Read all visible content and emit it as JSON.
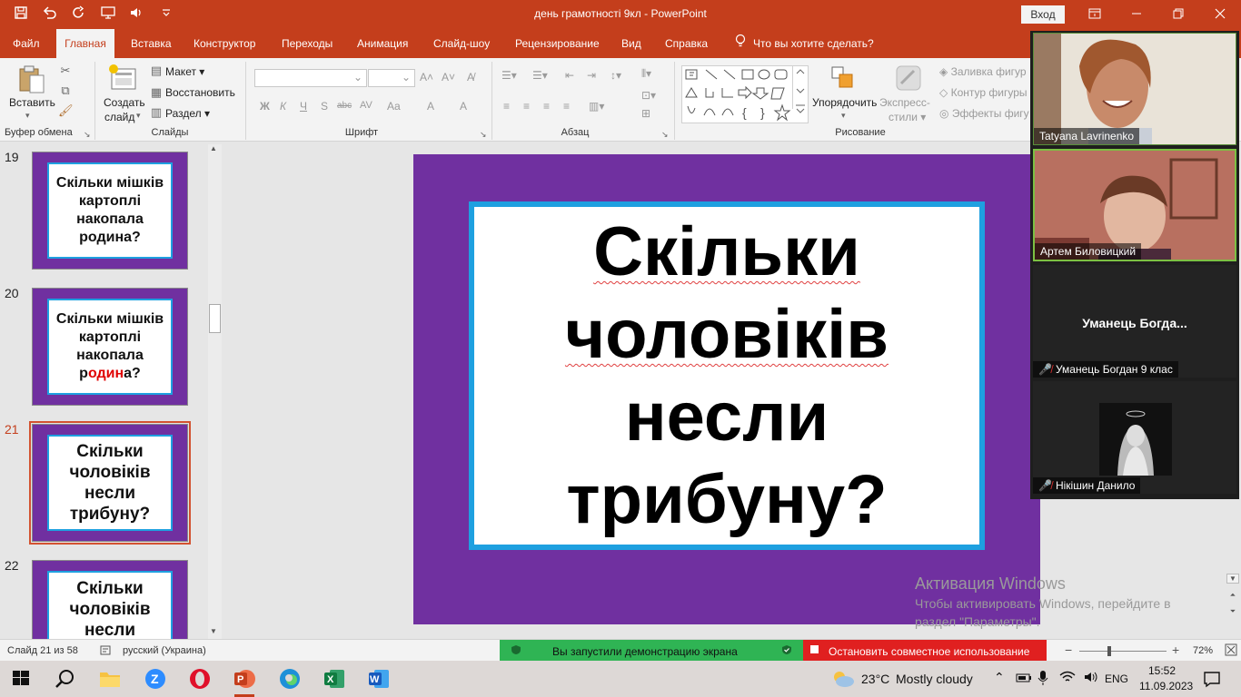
{
  "app": {
    "doc_title": "день грамотності 9кл  -  PowerPoint",
    "signin_label": "Вход"
  },
  "qat_icons": [
    "save-icon",
    "undo-icon",
    "redo-icon",
    "present-icon",
    "speaker-icon",
    "customize-icon"
  ],
  "tabs": [
    "Файл",
    "Главная",
    "Вставка",
    "Конструктор",
    "Переходы",
    "Анимация",
    "Слайд-шоу",
    "Рецензирование",
    "Вид",
    "Справка"
  ],
  "tell_me": "Что вы хотите сделать?",
  "ribbon": {
    "clipboard": {
      "paste": "Вставить",
      "label": "Буфер обмена"
    },
    "slides": {
      "new_slide_1": "Создать",
      "new_slide_2": "слайд",
      "layout": "Макет",
      "reset": "Восстановить",
      "section": "Раздел",
      "label": "Слайды"
    },
    "font": {
      "label": "Шрифт",
      "bold": "Ж",
      "italic": "К",
      "underline": "Ч",
      "shadow": "S",
      "strike": "abc",
      "spacing": "AV",
      "case": "Aa",
      "highlight": "A",
      "color": "A"
    },
    "paragraph": {
      "label": "Абзац"
    },
    "drawing": {
      "arrange_1": "Упорядочить",
      "quick_styles_1": "Экспресс-",
      "quick_styles_2": "стили",
      "fill": "Заливка фигур",
      "outline": "Контур фигуры",
      "effects": "Эффекты фигу",
      "label": "Рисование"
    }
  },
  "thumbnails": [
    {
      "num": "19",
      "text": "Скільки мішків картоплі накопала родина?"
    },
    {
      "num": "20",
      "text_pre": "Скільки мішків картоплі накопала р",
      "text_red": "один",
      "text_post": "а?"
    },
    {
      "num": "21",
      "text": "Скільки чоловіків несли трибуну?",
      "selected": true
    },
    {
      "num": "22",
      "text": "Скільки чоловіків несли"
    }
  ],
  "slide": {
    "line1": "Скільки",
    "line2": "чоловіків",
    "line3": "несли",
    "line4": "трибуну?"
  },
  "zoom_participants": [
    {
      "name": "Tatyana Lavrinenko",
      "muted": false
    },
    {
      "name": "Артем Биловицкий",
      "muted": false
    },
    {
      "name": "Уманець Богдан 9 клас",
      "display": "Уманець  Богда...",
      "muted": true
    },
    {
      "name": "Нікішин Данило",
      "muted": true
    }
  ],
  "activation": {
    "title": "Активация Windows",
    "line1": "Чтобы активировать Windows, перейдите в",
    "line2": "раздел \"Параметры\"."
  },
  "statusbar": {
    "slide_info": "Слайд 21 из 58",
    "language": "русский (Украина)",
    "share_notice": "Вы запустили демонстрацию экрана",
    "stop_share": "Остановить совместное использование",
    "zoom_level": "72%"
  },
  "taskbar": {
    "weather_temp": "23°C",
    "weather_desc": "Mostly cloudy",
    "lang": "ENG",
    "time": "15:52",
    "date": "11.09.2023"
  },
  "colors": {
    "accent": "#c43e1c",
    "slide_bg": "#7030a0",
    "slide_border": "#1ea0e0",
    "share_green": "#2fb454",
    "share_red": "#e02020"
  }
}
